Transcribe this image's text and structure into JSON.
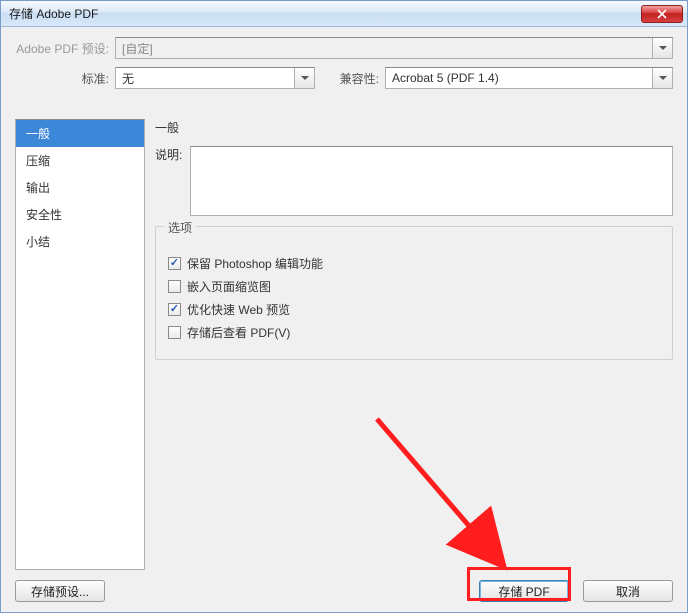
{
  "window": {
    "title": "存储 Adobe PDF"
  },
  "preset": {
    "label": "Adobe PDF 预设:",
    "value": "[自定]"
  },
  "standard": {
    "label": "标准:",
    "value": "无"
  },
  "compat": {
    "label": "兼容性:",
    "value": "Acrobat 5 (PDF 1.4)"
  },
  "sidebar": {
    "items": [
      {
        "label": "一般",
        "selected": true
      },
      {
        "label": "压缩",
        "selected": false
      },
      {
        "label": "输出",
        "selected": false
      },
      {
        "label": "安全性",
        "selected": false
      },
      {
        "label": "小结",
        "selected": false
      }
    ]
  },
  "detail": {
    "heading": "一般",
    "description_label": "说明:",
    "description_value": "",
    "options_legend": "选项",
    "options": [
      {
        "label": "保留 Photoshop 编辑功能",
        "checked": true
      },
      {
        "label": "嵌入页面缩览图",
        "checked": false
      },
      {
        "label": "优化快速 Web 预览",
        "checked": true
      },
      {
        "label": "存储后查看 PDF(V)",
        "checked": false
      }
    ]
  },
  "buttons": {
    "save_preset": "存储预设...",
    "save_pdf": "存储 PDF",
    "cancel": "取消"
  }
}
